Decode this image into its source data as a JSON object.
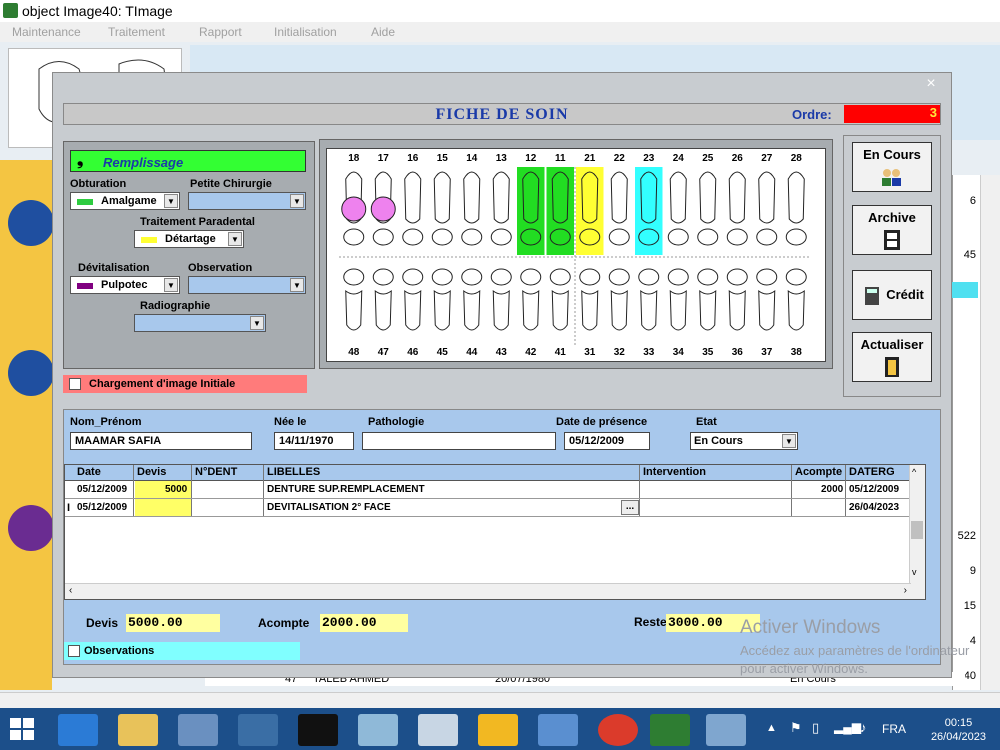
{
  "app": {
    "title": "object Image40: TImage",
    "menu": [
      "Maintenance",
      "Traitement",
      "Rapport",
      "Initialisation",
      "Aide"
    ]
  },
  "background": {
    "grid_numbers": [
      "6",
      "45",
      "522",
      "9",
      "15",
      "4",
      "40"
    ],
    "bottom_row": [
      "47",
      "TALEB AHMED",
      "20/07/1980",
      "En Cours"
    ]
  },
  "fiche": {
    "title": "FICHE DE SOIN",
    "ordre_label": "Ordre:",
    "ordre_value": "3"
  },
  "treatment": {
    "remplissage_label": "Remplissage",
    "obturation_label": "Obturation",
    "obturation_value": "Amalgame",
    "obturation_color": "#2ecc40",
    "petite_chirurgie_label": "Petite Chirurgie",
    "trait_parodental_label": "Traitement Paradental",
    "trait_parodental_value": "Détartage",
    "trait_parodental_color": "#ffff33",
    "devitalisation_label": "Dévitalisation",
    "devitalisation_value": "Pulpotec",
    "devitalisation_color": "#800080",
    "observation_label": "Observation",
    "radiographie_label": "Radiographie",
    "chargement_label": "Chargement d'image Initiale"
  },
  "chart_data": {
    "type": "table",
    "upper_teeth": [
      "18",
      "17",
      "16",
      "15",
      "14",
      "13",
      "12",
      "11",
      "21",
      "22",
      "23",
      "24",
      "25",
      "26",
      "27",
      "28"
    ],
    "lower_teeth": [
      "48",
      "47",
      "46",
      "45",
      "44",
      "43",
      "42",
      "41",
      "31",
      "32",
      "33",
      "34",
      "35",
      "36",
      "37",
      "38"
    ],
    "highlights": [
      {
        "teeth": [
          "17",
          "18"
        ],
        "color": "#ee82ee"
      },
      {
        "teeth": [
          "12",
          "11"
        ],
        "color": "#22dd22"
      },
      {
        "teeth": [
          "21"
        ],
        "color": "#ffff33"
      },
      {
        "teeth": [
          "23"
        ],
        "color": "#33ffff"
      }
    ]
  },
  "side_buttons": [
    {
      "label": "En Cours",
      "icon": "people-icon"
    },
    {
      "label": "Archive",
      "icon": "film-icon"
    },
    {
      "label": "Crédit",
      "icon": "calculator-icon"
    },
    {
      "label": "Actualiser",
      "icon": "door-icon"
    }
  ],
  "patient": {
    "nom_label": "Nom_Prénom",
    "nom_value": "MAAMAR SAFIA",
    "nee_label": "Née le",
    "nee_value": "14/11/1970",
    "pathologie_label": "Pathologie",
    "pathologie_value": "",
    "date_label": "Date de présence",
    "date_value": "05/12/2009",
    "etat_label": "Etat",
    "etat_value": "En Cours"
  },
  "grid": {
    "headers": [
      "Date",
      "Devis",
      "N°DENT",
      "LIBELLES",
      "Intervention",
      "Acompte",
      "DATERG"
    ],
    "rows": [
      {
        "date": "05/12/2009",
        "devis": "5000",
        "ndent": "",
        "libelle": "DENTURE SUP.REMPLACEMENT",
        "intervention": "",
        "acompte": "2000",
        "daterg": "05/12/2009"
      },
      {
        "date": "05/12/2009",
        "devis": "",
        "ndent": "",
        "libelle": "DEVITALISATION 2° FACE",
        "intervention": "",
        "acompte": "",
        "daterg": "26/04/2023"
      }
    ],
    "ellipsis": "..."
  },
  "summary": {
    "devis_label": "Devis",
    "devis_value": "5000.00",
    "acompte_label": "Acompte",
    "acompte_value": "2000.00",
    "reste_label": "Reste",
    "reste_value": "3000.00",
    "observations_label": "Observations"
  },
  "watermark": {
    "title": "Activer Windows",
    "sub": "Accédez aux paramètres de l'ordinateur pour activer Windows."
  },
  "taskbar": {
    "lang": "FRA",
    "time": "00:15",
    "date": "26/04/2023"
  }
}
